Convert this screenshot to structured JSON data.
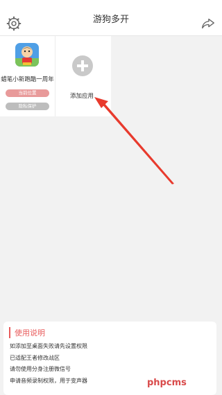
{
  "header": {
    "title": "游狗多开",
    "left_icon": "gear-icon",
    "right_icon": "share-icon"
  },
  "apps": [
    {
      "name": "蜡笔小新跑酷一周年",
      "icon": "crayon-shin-chan-app-icon",
      "location_button": "当前位置",
      "privacy_button": "隐私保护"
    }
  ],
  "add_app": {
    "label": "添加应用",
    "icon": "plus-icon"
  },
  "annotation": {
    "type": "arrow",
    "color": "#e83a2d"
  },
  "instructions": {
    "title": "使用说明",
    "lines": [
      "如添加至桌面失败请先设置权限",
      "已适配王者修改战区",
      "请勿使用分身注册微信号",
      "申请音频录制权限，用于变声器"
    ]
  },
  "watermark": "phpcms",
  "colors": {
    "accent": "#e85b5b",
    "location_button": "#e89a9a",
    "privacy_button": "#bdbdbd",
    "background": "#f2f2f2"
  }
}
